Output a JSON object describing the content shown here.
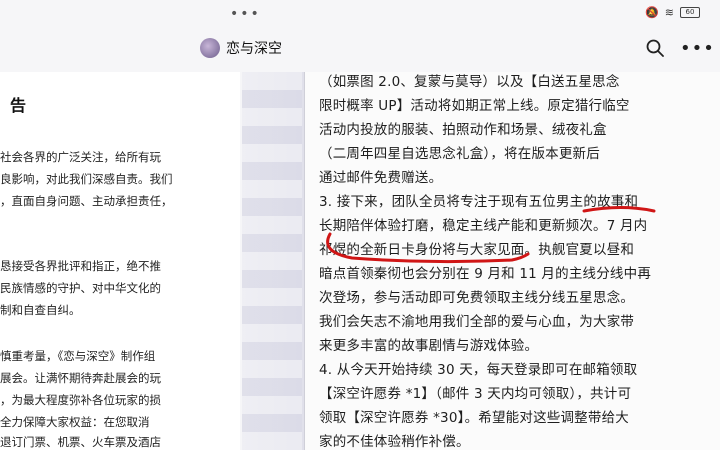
{
  "topbar": {
    "dots": "•••",
    "status_text": "≋",
    "battery": "60",
    "title": "恋与深空"
  },
  "left_doc": {
    "heading": "告",
    "lines": [
      "社会各界的广泛关注，给所有玩",
      "良影响，对此我们深感自责。我们",
      "，直面自身问题、主动承担责任，",
      "",
      "恳接受各界批评和指正，绝不推",
      "民族情感的守护、对中华文化的",
      "制和自查自纠。",
      "",
      "慎重考量，《恋与深空》制作组",
      "展会。让满怀期待奔赴展会的玩",
      "，为最大程度弥补各位玩家的损",
      "全力保障大家权益：在您取消",
      "退订门票、机票、火车票及酒店"
    ]
  },
  "doc": {
    "lines": [
      "（如票图 2.0、复蒙与莫导）以及【白送五星思念",
      "限时概率 UP】活动将如期正常上线。原定猎行临空",
      "活动内投放的服装、拍照动作和场景、绒夜礼盒",
      "（二周年四星自选思念礼盒），将在版本更新后",
      "通过邮件免费赠送。",
      "3. 接下来，团队全员将专注于现有五位男主的故事和",
      "长期陪伴体验打磨，稳定主线产能和更新频次。7 月内",
      "祁煜的全新日卡身份将与大家见面。执舰官夏以昼和",
      "暗点首领秦彻也会分别在 9 月和 11 月的主线分线中再",
      "次登场，参与活动即可免费领取主线分线五星思念。",
      "我们会矢志不渝地用我们全部的爱与心血，为大家带",
      "来更多丰富的故事剧情与游戏体验。",
      "4. 从今天开始持续 30 天，每天登录即可在邮箱领取",
      "【深空许愿券 *1】（邮件 3 天内均可领取），共计可",
      "领取【深空许愿券 *30】。希望能对这些调整带给大",
      "家的不佳体验稍作补偿。"
    ]
  },
  "colors": {
    "annotation": "#d01616"
  },
  "icons": [
    "search-icon",
    "more-icon",
    "wifi-icon",
    "battery-icon",
    "avatar"
  ]
}
